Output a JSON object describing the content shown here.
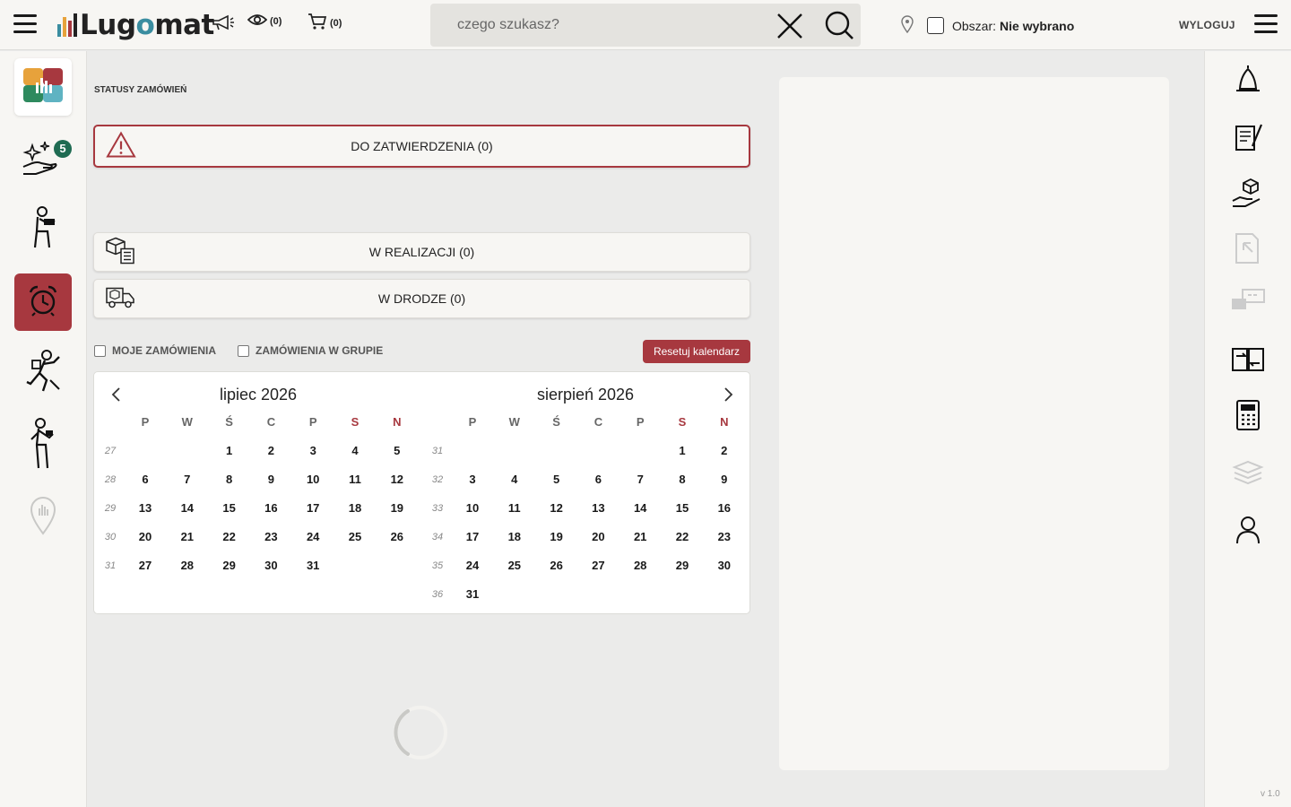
{
  "topbar": {
    "logo": "Lugomat",
    "watch_count": "(0)",
    "cart_count": "(0)",
    "search_placeholder": "czego szukasz?",
    "area_label": "Obszar:",
    "area_value": "Nie wybrano",
    "logout": "WYLOGUJ"
  },
  "main": {
    "section_title": "STATUSY ZAMÓWIEŃ",
    "statuses": {
      "pending": "DO ZATWIERDZENIA (0)",
      "in_progress": "W REALIZACJI (0)",
      "in_transit": "W DRODZE (0)"
    },
    "filters": {
      "my_orders": "MOJE ZAMÓWIENIA",
      "group_orders": "ZAMÓWIENIA W GRUPIE"
    },
    "reset_button": "Resetuj kalendarz"
  },
  "sidebar_left": {
    "badge_count": "5"
  },
  "calendar": {
    "weekdays": [
      "P",
      "W",
      "Ś",
      "C",
      "P",
      "S",
      "N"
    ],
    "months": [
      {
        "title": "lipiec 2026",
        "first_weekday": 2,
        "days": 31,
        "weeks": [
          "27",
          "28",
          "29",
          "30",
          "31"
        ]
      },
      {
        "title": "sierpień 2026",
        "first_weekday": 5,
        "days": 31,
        "weeks": [
          "31",
          "32",
          "33",
          "34",
          "35",
          "36"
        ]
      }
    ]
  },
  "colors": {
    "accent": "#a7383f",
    "background": "#ebebea",
    "panel": "#f7f6f3"
  },
  "version": "v 1.0"
}
